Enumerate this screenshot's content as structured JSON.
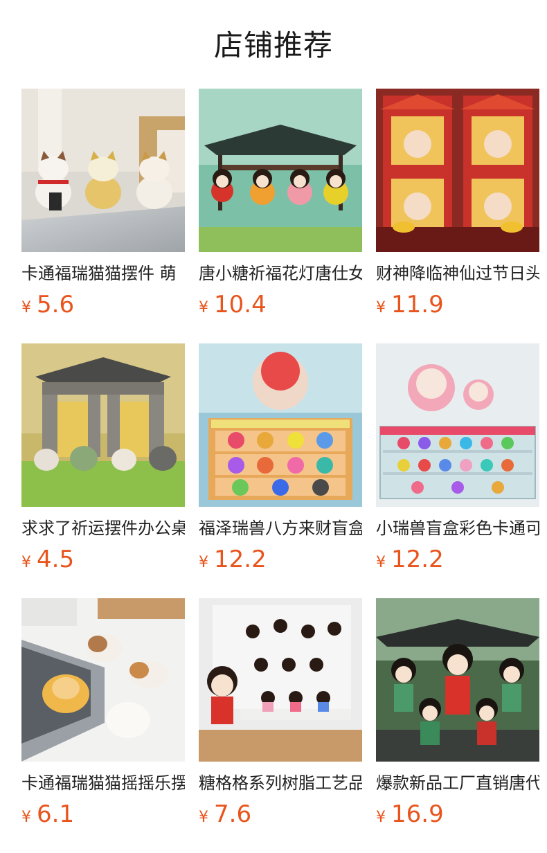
{
  "header": {
    "title": "店铺推荐"
  },
  "currency_symbol": "¥",
  "products": [
    {
      "name": "卡通福瑞猫猫摆件 萌",
      "price": "5.6",
      "image": "three-lucky-cats-figurines"
    },
    {
      "name": "唐小糖祈福花灯唐仕女",
      "price": "10.4",
      "image": "tang-girls-with-pavilion"
    },
    {
      "name": "财神降临神仙过节日头",
      "price": "11.9",
      "image": "god-of-wealth-red-shrine"
    },
    {
      "name": "求求了祈运摆件办公桌",
      "price": "4.5",
      "image": "praying-frogs-stone-gate"
    },
    {
      "name": "福泽瑞兽八方来财盲盒",
      "price": "12.2",
      "image": "auspicious-beasts-blind-box-display"
    },
    {
      "name": "小瑞兽盲盒彩色卡通可",
      "price": "12.2",
      "image": "little-lion-dance-blind-box-display"
    },
    {
      "name": "卡通福瑞猫猫摇摇乐摆",
      "price": "6.1",
      "image": "sleeping-cats-on-laptop"
    },
    {
      "name": "糖格格系列树脂工艺品",
      "price": "7.6",
      "image": "qing-princess-figurines-pegboard"
    },
    {
      "name": "爆款新品工厂直销唐代",
      "price": "16.9",
      "image": "tang-ladies-playing-instruments"
    }
  ]
}
